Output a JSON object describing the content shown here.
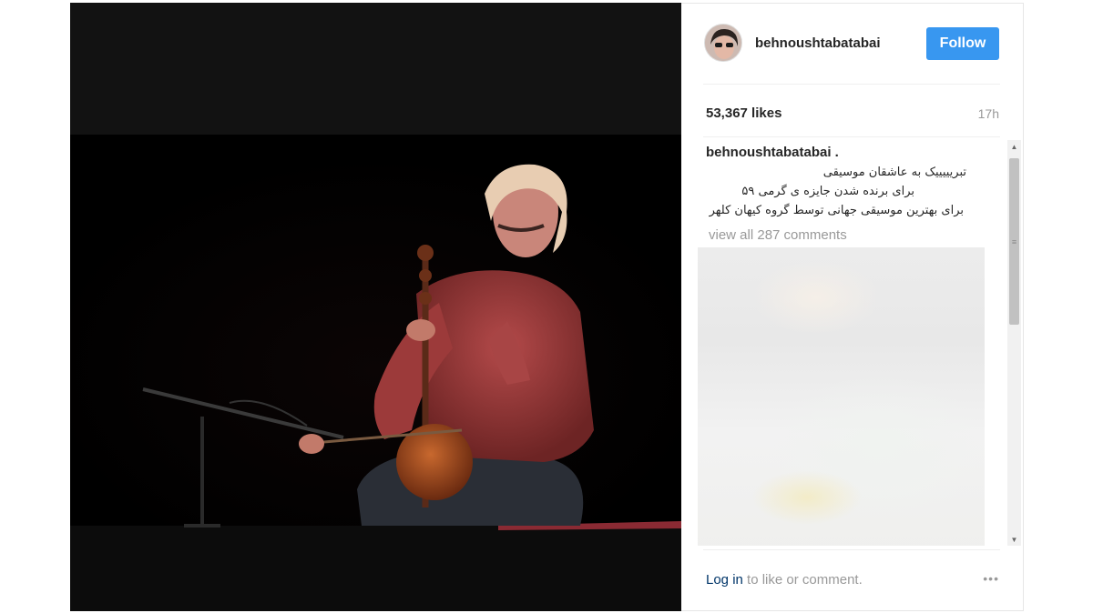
{
  "post": {
    "username": "behnoushtabatabai",
    "follow_label": "Follow",
    "likes": "53,367 likes",
    "time": "17h",
    "caption_user": "behnoushtabatabai .",
    "caption_lines": [
      "تبریییییک به عاشقان موسیقی",
      "برای برنده شدن جایزه ی گرمی ۵۹",
      "برای بهترین موسیقی جهانی توسط گروه کیهان کلهر"
    ],
    "view_all_comments": "view all 287 comments",
    "login_link": "Log in",
    "login_suffix": " to like or comment.",
    "more_icon": "•••"
  },
  "colors": {
    "follow_button": "#3897f0",
    "login_link": "#003569",
    "photo_background": "#000000"
  }
}
